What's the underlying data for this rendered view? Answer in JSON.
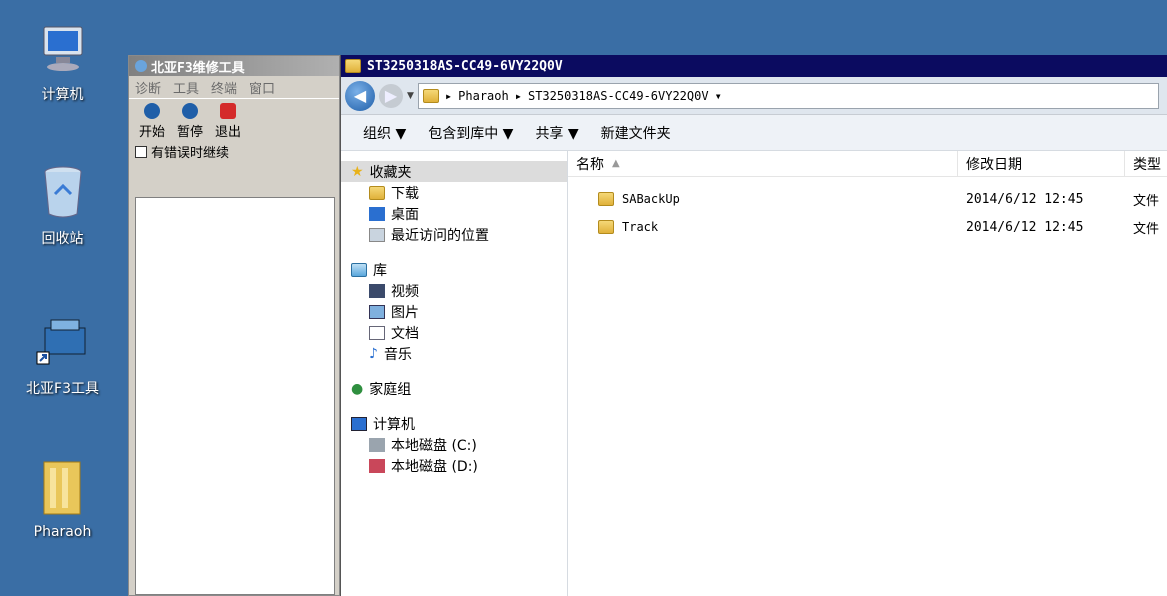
{
  "desktop": {
    "icons": [
      {
        "label": "计算机",
        "icon": "computer-icon"
      },
      {
        "label": "回收站",
        "icon": "recycle-bin-icon"
      },
      {
        "label": "北亚F3工具",
        "icon": "toolbox-shortcut-icon"
      },
      {
        "label": "Pharaoh",
        "icon": "folder-icon"
      }
    ]
  },
  "tool_window": {
    "title": "北亚F3维修工具",
    "menu": [
      "诊断",
      "工具",
      "终端",
      "窗口"
    ],
    "toolbar": [
      {
        "label": "开始",
        "icon": "play-icon",
        "color": "#1f5ea8"
      },
      {
        "label": "暂停",
        "icon": "pause-icon",
        "color": "#1f5ea8"
      },
      {
        "label": "退出",
        "icon": "power-icon",
        "color": "#d42a2a"
      }
    ],
    "checkbox_label": "有错误时继续"
  },
  "explorer": {
    "title": "ST3250318AS-CC49-6VY22Q0V",
    "breadcrumb": [
      "Pharaoh",
      "ST3250318AS-CC49-6VY22Q0V"
    ],
    "commands": [
      "组织 ▼",
      "包含到库中 ▼",
      "共享 ▼",
      "新建文件夹"
    ],
    "nav": {
      "favorites": "收藏夹",
      "favorites_items": [
        "下载",
        "桌面",
        "最近访问的位置"
      ],
      "libraries": "库",
      "libraries_items": [
        "视频",
        "图片",
        "文档",
        "音乐"
      ],
      "homegroup": "家庭组",
      "computer": "计算机",
      "computer_items": [
        "本地磁盘 (C:)",
        "本地磁盘 (D:)"
      ]
    },
    "columns": {
      "name": "名称",
      "modified": "修改日期",
      "type": "类型"
    },
    "files": [
      {
        "name": "SABackUp",
        "modified": "2014/6/12 12:45",
        "type": "文件"
      },
      {
        "name": "Track",
        "modified": "2014/6/12 12:45",
        "type": "文件"
      }
    ]
  },
  "colors": {
    "desktop": "#3a6ea5",
    "title_active": "#0b0b60"
  }
}
